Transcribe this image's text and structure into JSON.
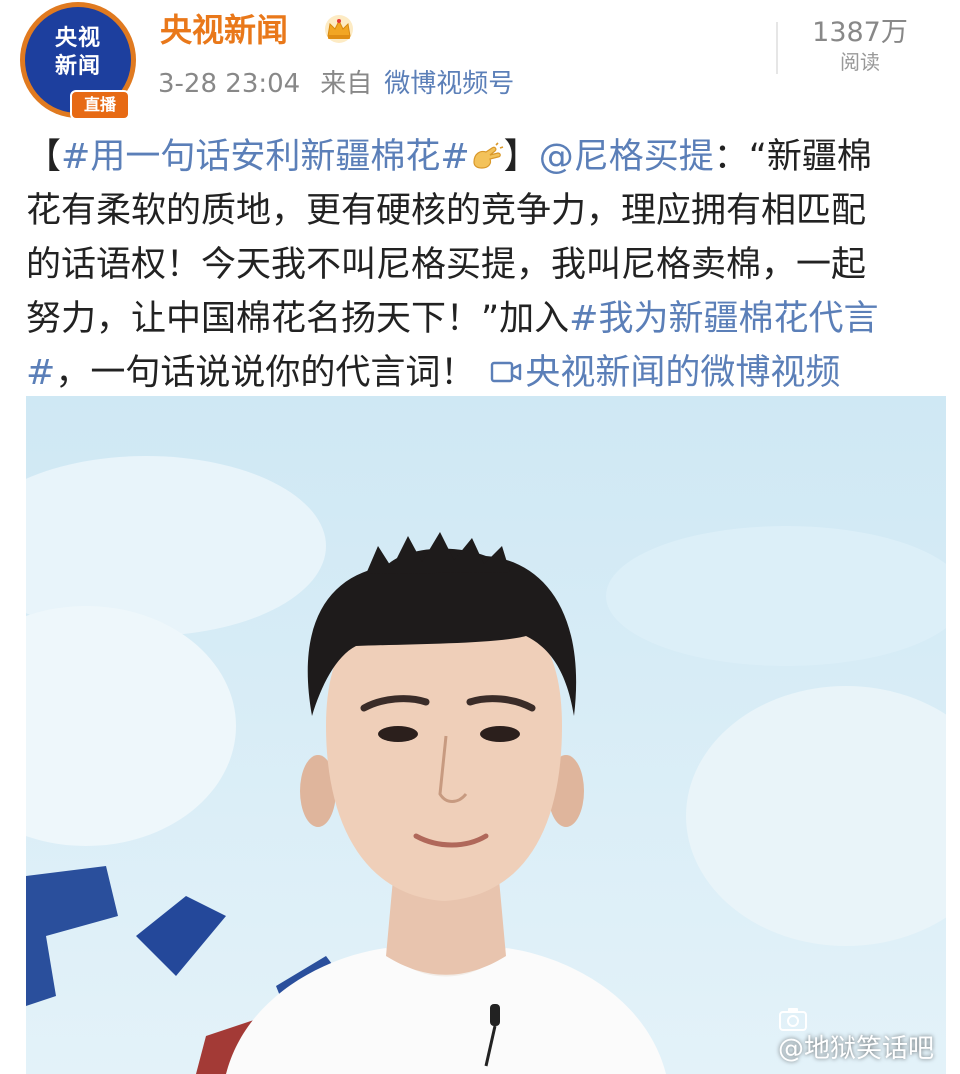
{
  "account": {
    "name": "央视新闻",
    "avatar": {
      "line1": "央视",
      "line2": "新闻",
      "at_mark": "@",
      "badge": "直播"
    },
    "verified_icon": "crown-icon"
  },
  "meta": {
    "time": "3-28 23:04",
    "from_label": "来自",
    "source": "微博视频号"
  },
  "stats": {
    "reads_count": "1387万",
    "reads_label": "阅读"
  },
  "post": {
    "lines": [
      {
        "open_bracket": "【",
        "topic": "#用一句话安利新疆棉花#",
        "close_bracket": "】",
        "mention": "@尼格买提",
        "rest": "：“新疆棉"
      },
      "花有柔软的质地，更有硬核的竞争力，理应拥有相匹配",
      "的话语权！今天我不叫尼格买提，我叫尼格卖棉，一起",
      {
        "text": "努力，让中国棉花名扬天下！”加入",
        "topic_part": "#我为新疆棉花代言"
      },
      {
        "topic_end": "#",
        "text": "，一句话说说你的代言词！",
        "video_link": "央视新闻的微博视频"
      }
    ]
  },
  "watermark": {
    "text": "@地狱笑话吧"
  },
  "colors": {
    "brand_orange": "#e9781a",
    "link_blue": "#5b7fb8",
    "meta_gray": "#888888",
    "avatar_blue": "#1d3f9e"
  }
}
